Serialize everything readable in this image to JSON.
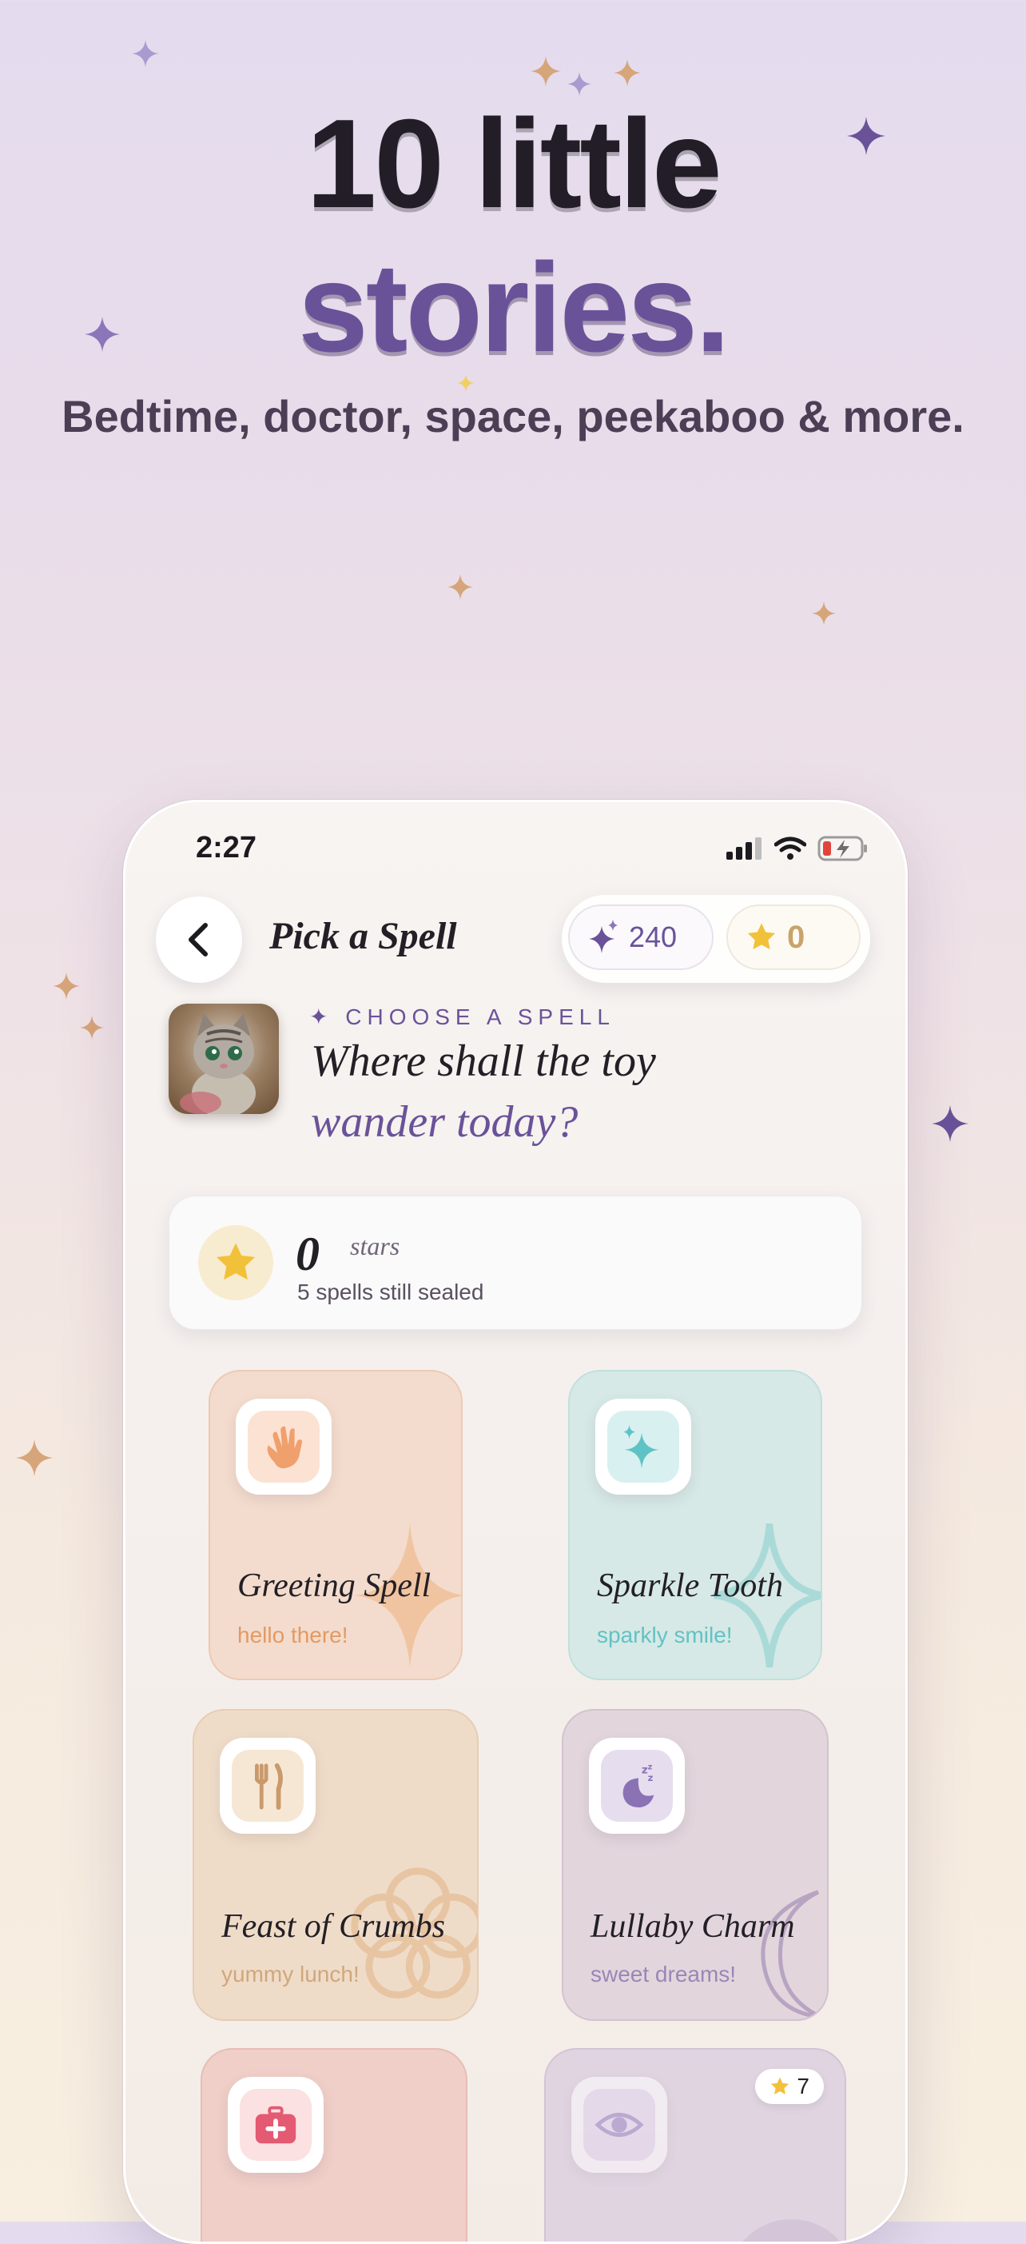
{
  "headline": {
    "line1": "10 little",
    "line2": "stories.",
    "subtitle": "Bedtime, doctor, space, peekaboo & more."
  },
  "colors": {
    "accent_purple": "#6a5299",
    "gold": "#c9a36a",
    "dark": "#231f26"
  },
  "status_bar": {
    "time": "2:27",
    "icons": [
      "signal-icon",
      "wifi-icon",
      "battery-charging-icon"
    ]
  },
  "header": {
    "back_icon": "chevron-left-icon",
    "title": "Pick a Spell",
    "sparkles_count": "240",
    "stars_count": "0"
  },
  "intro": {
    "kicker": "CHOOSE A SPELL",
    "question_line1": "Where shall the toy",
    "question_line2": "wander today?"
  },
  "star_summary": {
    "count": "0",
    "label": "stars",
    "subtitle": "5 spells still sealed"
  },
  "spells": [
    {
      "title": "Greeting Spell",
      "subtitle": "hello there!",
      "icon": "waving-hand-icon"
    },
    {
      "title": "Sparkle Tooth",
      "subtitle": "sparkly smile!",
      "icon": "sparkle-icon"
    },
    {
      "title": "Feast of Crumbs",
      "subtitle": "yummy lunch!",
      "icon": "fork-knife-icon"
    },
    {
      "title": "Lullaby Charm",
      "subtitle": "sweet dreams!",
      "icon": "moon-zzz-icon"
    },
    {
      "title": "",
      "subtitle": "",
      "icon": "first-aid-kit-icon"
    },
    {
      "title": "",
      "subtitle": "",
      "icon": "eye-icon",
      "required_stars": "7"
    }
  ]
}
